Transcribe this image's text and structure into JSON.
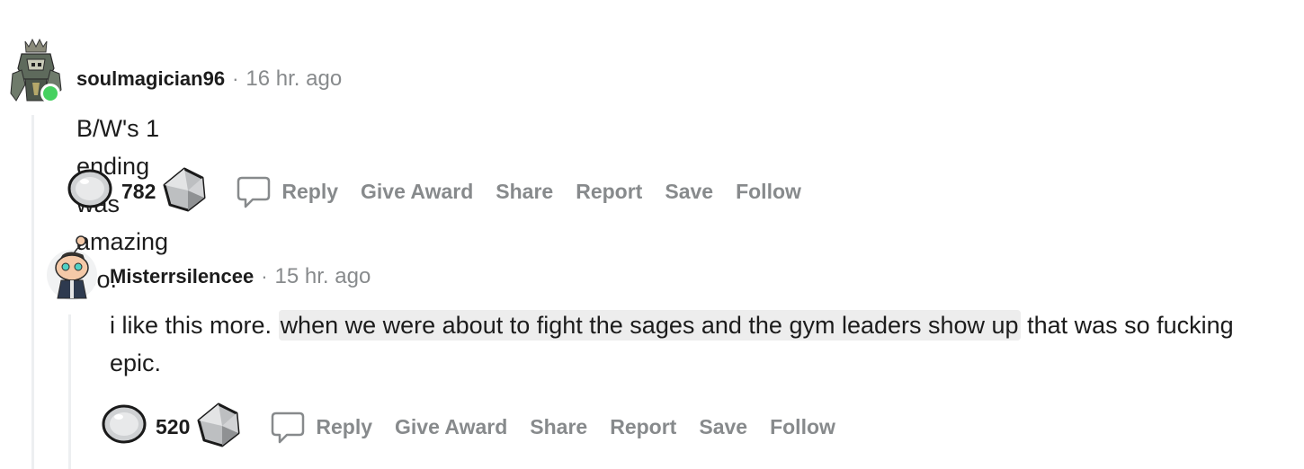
{
  "comments": [
    {
      "username": "soulmagician96",
      "separator": "·",
      "time": "16 hr. ago",
      "body": "B/W's 1 ending was amazing too.",
      "score": "782",
      "actions": {
        "reply": "Reply",
        "give_award": "Give Award",
        "share": "Share",
        "report": "Report",
        "save": "Save",
        "follow": "Follow"
      }
    },
    {
      "username": "Misterrsilencee",
      "separator": "·",
      "time": "15 hr. ago",
      "body_pre": "i like this more. ",
      "body_highlight": "when we were about to fight the sages and the gym leaders show up",
      "body_post": " that was so fucking epic.",
      "score": "520",
      "actions": {
        "reply": "Reply",
        "give_award": "Give Award",
        "share": "Share",
        "report": "Report",
        "save": "Save",
        "follow": "Follow"
      }
    }
  ],
  "colors": {
    "online": "#46d160",
    "muted": "#878a8c",
    "thread_line": "#edeff1",
    "highlight": "#ededed"
  },
  "icons": {
    "upvote": "upvote-icon",
    "downvote": "downvote-icon",
    "reply": "reply-bubble-icon"
  }
}
